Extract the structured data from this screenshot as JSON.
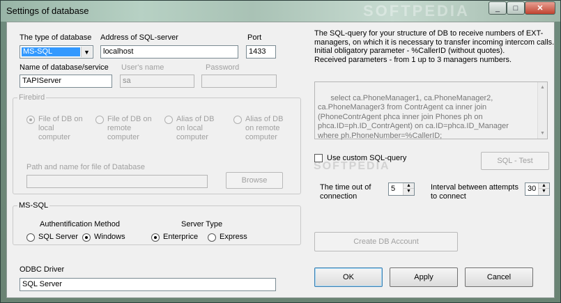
{
  "window": {
    "title": "Settings of database",
    "watermark": "SOFTPEDIA",
    "min_glyph": "_",
    "max_glyph": "□",
    "close_glyph": "✕"
  },
  "db": {
    "type_label": "The type of database",
    "type_value": "MS-SQL",
    "address_label": "Address of SQL-server",
    "address_value": "localhost",
    "port_label": "Port",
    "port_value": "1433",
    "name_label": "Name of database/service",
    "name_value": "TAPIServer",
    "user_label": "User's name",
    "user_value": "sa",
    "password_label": "Password",
    "password_value": ""
  },
  "firebird": {
    "group_label": "Firebird",
    "options": [
      {
        "label": "File of DB on\nlocal\ncomputer",
        "selected": true
      },
      {
        "label": "File of DB on\nremote\ncomputer",
        "selected": false
      },
      {
        "label": "Alias of DB\non local\ncomputer",
        "selected": false
      },
      {
        "label": "Alias of DB\non remote\ncomputer",
        "selected": false
      }
    ],
    "path_label": "Path and name for file of Database",
    "path_value": "",
    "browse_label": "Browse"
  },
  "mssql": {
    "group_label": "MS-SQL",
    "auth_label": "Authentification Method",
    "auth_options": [
      {
        "label": "SQL Server",
        "selected": false
      },
      {
        "label": "Windows",
        "selected": true
      }
    ],
    "server_type_label": "Server Type",
    "server_options": [
      {
        "label": "Enterprice",
        "selected": true
      },
      {
        "label": "Express",
        "selected": false
      }
    ]
  },
  "odbc": {
    "label": "ODBC Driver",
    "value": "SQL Server"
  },
  "info_text": "The SQL-query for your structure of DB to receive numbers of EXT-\nmanagers, on which it is necessary to transfer incoming intercom calls.\nInitial obligatory parameter - %CallerID (without quotes).\nReceived parameters - from 1 up to 3 managers numbers.",
  "sql_query": "select ca.PhoneManager1, ca.PhoneManager2,\nca.PhoneManager3 from ContrAgent ca inner join\n(PhoneContrAgent phca inner join Phones ph on\nphca.ID=ph.ID_ContrAgent) on ca.ID=phca.ID_Manager\nwhere ph.PhoneNumber=%CallerID;",
  "custom_sql": {
    "label": "Use custom SQL-query",
    "checked": false,
    "test_button": "SQL - Test"
  },
  "timeout": {
    "label": "The time out of\nconnection",
    "value": "5"
  },
  "interval": {
    "label": "Interval between attempts\nto connect",
    "value": "30"
  },
  "create_account_button": "Create DB Account",
  "buttons": {
    "ok": "OK",
    "apply": "Apply",
    "cancel": "Cancel"
  }
}
